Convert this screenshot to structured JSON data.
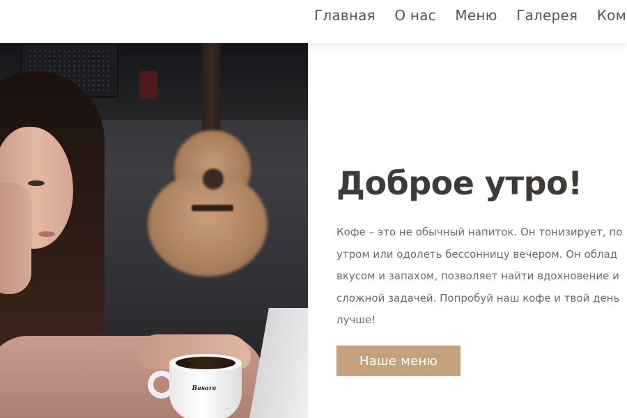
{
  "header": {
    "nav": [
      {
        "label": "Главная"
      },
      {
        "label": "О нас"
      },
      {
        "label": "Меню"
      },
      {
        "label": "Галерея"
      },
      {
        "label": "Кома"
      }
    ]
  },
  "hero": {
    "image": {
      "logo_text": "Basara"
    },
    "title": "Доброе утро!",
    "text": "Кофе – это не обычный напиток. Он тонизирует, по утром или одолеть бессонницу вечером. Он облад вкусом и запахом, позволяет найти вдохновение и сложной задачей. Попробуй наш кофе и твой день лучше!",
    "button_label": "Наше меню"
  },
  "colors": {
    "accent": "#c4a27d",
    "heading": "#3d3a38",
    "body_text": "#6b6b6b",
    "nav_text": "#555555"
  }
}
